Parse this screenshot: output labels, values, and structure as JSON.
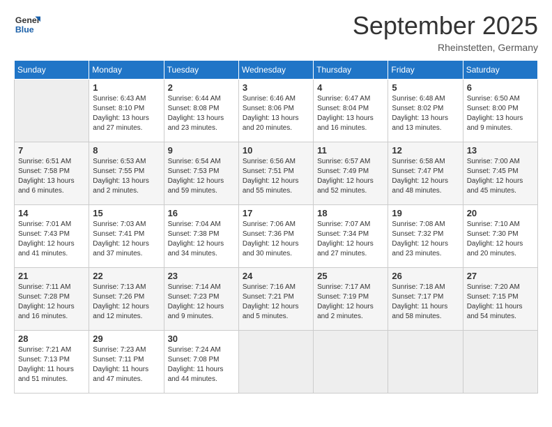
{
  "header": {
    "logo_general": "General",
    "logo_blue": "Blue",
    "month_title": "September 2025",
    "location": "Rheinstetten, Germany"
  },
  "weekdays": [
    "Sunday",
    "Monday",
    "Tuesday",
    "Wednesday",
    "Thursday",
    "Friday",
    "Saturday"
  ],
  "weeks": [
    [
      {
        "day": "",
        "sunrise": "",
        "sunset": "",
        "daylight": "",
        "empty": true
      },
      {
        "day": "1",
        "sunrise": "Sunrise: 6:43 AM",
        "sunset": "Sunset: 8:10 PM",
        "daylight": "Daylight: 13 hours and 27 minutes."
      },
      {
        "day": "2",
        "sunrise": "Sunrise: 6:44 AM",
        "sunset": "Sunset: 8:08 PM",
        "daylight": "Daylight: 13 hours and 23 minutes."
      },
      {
        "day": "3",
        "sunrise": "Sunrise: 6:46 AM",
        "sunset": "Sunset: 8:06 PM",
        "daylight": "Daylight: 13 hours and 20 minutes."
      },
      {
        "day": "4",
        "sunrise": "Sunrise: 6:47 AM",
        "sunset": "Sunset: 8:04 PM",
        "daylight": "Daylight: 13 hours and 16 minutes."
      },
      {
        "day": "5",
        "sunrise": "Sunrise: 6:48 AM",
        "sunset": "Sunset: 8:02 PM",
        "daylight": "Daylight: 13 hours and 13 minutes."
      },
      {
        "day": "6",
        "sunrise": "Sunrise: 6:50 AM",
        "sunset": "Sunset: 8:00 PM",
        "daylight": "Daylight: 13 hours and 9 minutes."
      }
    ],
    [
      {
        "day": "7",
        "sunrise": "Sunrise: 6:51 AM",
        "sunset": "Sunset: 7:58 PM",
        "daylight": "Daylight: 13 hours and 6 minutes."
      },
      {
        "day": "8",
        "sunrise": "Sunrise: 6:53 AM",
        "sunset": "Sunset: 7:55 PM",
        "daylight": "Daylight: 13 hours and 2 minutes."
      },
      {
        "day": "9",
        "sunrise": "Sunrise: 6:54 AM",
        "sunset": "Sunset: 7:53 PM",
        "daylight": "Daylight: 12 hours and 59 minutes."
      },
      {
        "day": "10",
        "sunrise": "Sunrise: 6:56 AM",
        "sunset": "Sunset: 7:51 PM",
        "daylight": "Daylight: 12 hours and 55 minutes."
      },
      {
        "day": "11",
        "sunrise": "Sunrise: 6:57 AM",
        "sunset": "Sunset: 7:49 PM",
        "daylight": "Daylight: 12 hours and 52 minutes."
      },
      {
        "day": "12",
        "sunrise": "Sunrise: 6:58 AM",
        "sunset": "Sunset: 7:47 PM",
        "daylight": "Daylight: 12 hours and 48 minutes."
      },
      {
        "day": "13",
        "sunrise": "Sunrise: 7:00 AM",
        "sunset": "Sunset: 7:45 PM",
        "daylight": "Daylight: 12 hours and 45 minutes."
      }
    ],
    [
      {
        "day": "14",
        "sunrise": "Sunrise: 7:01 AM",
        "sunset": "Sunset: 7:43 PM",
        "daylight": "Daylight: 12 hours and 41 minutes."
      },
      {
        "day": "15",
        "sunrise": "Sunrise: 7:03 AM",
        "sunset": "Sunset: 7:41 PM",
        "daylight": "Daylight: 12 hours and 37 minutes."
      },
      {
        "day": "16",
        "sunrise": "Sunrise: 7:04 AM",
        "sunset": "Sunset: 7:38 PM",
        "daylight": "Daylight: 12 hours and 34 minutes."
      },
      {
        "day": "17",
        "sunrise": "Sunrise: 7:06 AM",
        "sunset": "Sunset: 7:36 PM",
        "daylight": "Daylight: 12 hours and 30 minutes."
      },
      {
        "day": "18",
        "sunrise": "Sunrise: 7:07 AM",
        "sunset": "Sunset: 7:34 PM",
        "daylight": "Daylight: 12 hours and 27 minutes."
      },
      {
        "day": "19",
        "sunrise": "Sunrise: 7:08 AM",
        "sunset": "Sunset: 7:32 PM",
        "daylight": "Daylight: 12 hours and 23 minutes."
      },
      {
        "day": "20",
        "sunrise": "Sunrise: 7:10 AM",
        "sunset": "Sunset: 7:30 PM",
        "daylight": "Daylight: 12 hours and 20 minutes."
      }
    ],
    [
      {
        "day": "21",
        "sunrise": "Sunrise: 7:11 AM",
        "sunset": "Sunset: 7:28 PM",
        "daylight": "Daylight: 12 hours and 16 minutes."
      },
      {
        "day": "22",
        "sunrise": "Sunrise: 7:13 AM",
        "sunset": "Sunset: 7:26 PM",
        "daylight": "Daylight: 12 hours and 12 minutes."
      },
      {
        "day": "23",
        "sunrise": "Sunrise: 7:14 AM",
        "sunset": "Sunset: 7:23 PM",
        "daylight": "Daylight: 12 hours and 9 minutes."
      },
      {
        "day": "24",
        "sunrise": "Sunrise: 7:16 AM",
        "sunset": "Sunset: 7:21 PM",
        "daylight": "Daylight: 12 hours and 5 minutes."
      },
      {
        "day": "25",
        "sunrise": "Sunrise: 7:17 AM",
        "sunset": "Sunset: 7:19 PM",
        "daylight": "Daylight: 12 hours and 2 minutes."
      },
      {
        "day": "26",
        "sunrise": "Sunrise: 7:18 AM",
        "sunset": "Sunset: 7:17 PM",
        "daylight": "Daylight: 11 hours and 58 minutes."
      },
      {
        "day": "27",
        "sunrise": "Sunrise: 7:20 AM",
        "sunset": "Sunset: 7:15 PM",
        "daylight": "Daylight: 11 hours and 54 minutes."
      }
    ],
    [
      {
        "day": "28",
        "sunrise": "Sunrise: 7:21 AM",
        "sunset": "Sunset: 7:13 PM",
        "daylight": "Daylight: 11 hours and 51 minutes."
      },
      {
        "day": "29",
        "sunrise": "Sunrise: 7:23 AM",
        "sunset": "Sunset: 7:11 PM",
        "daylight": "Daylight: 11 hours and 47 minutes."
      },
      {
        "day": "30",
        "sunrise": "Sunrise: 7:24 AM",
        "sunset": "Sunset: 7:08 PM",
        "daylight": "Daylight: 11 hours and 44 minutes."
      },
      {
        "day": "",
        "sunrise": "",
        "sunset": "",
        "daylight": "",
        "empty": true
      },
      {
        "day": "",
        "sunrise": "",
        "sunset": "",
        "daylight": "",
        "empty": true
      },
      {
        "day": "",
        "sunrise": "",
        "sunset": "",
        "daylight": "",
        "empty": true
      },
      {
        "day": "",
        "sunrise": "",
        "sunset": "",
        "daylight": "",
        "empty": true
      }
    ]
  ]
}
